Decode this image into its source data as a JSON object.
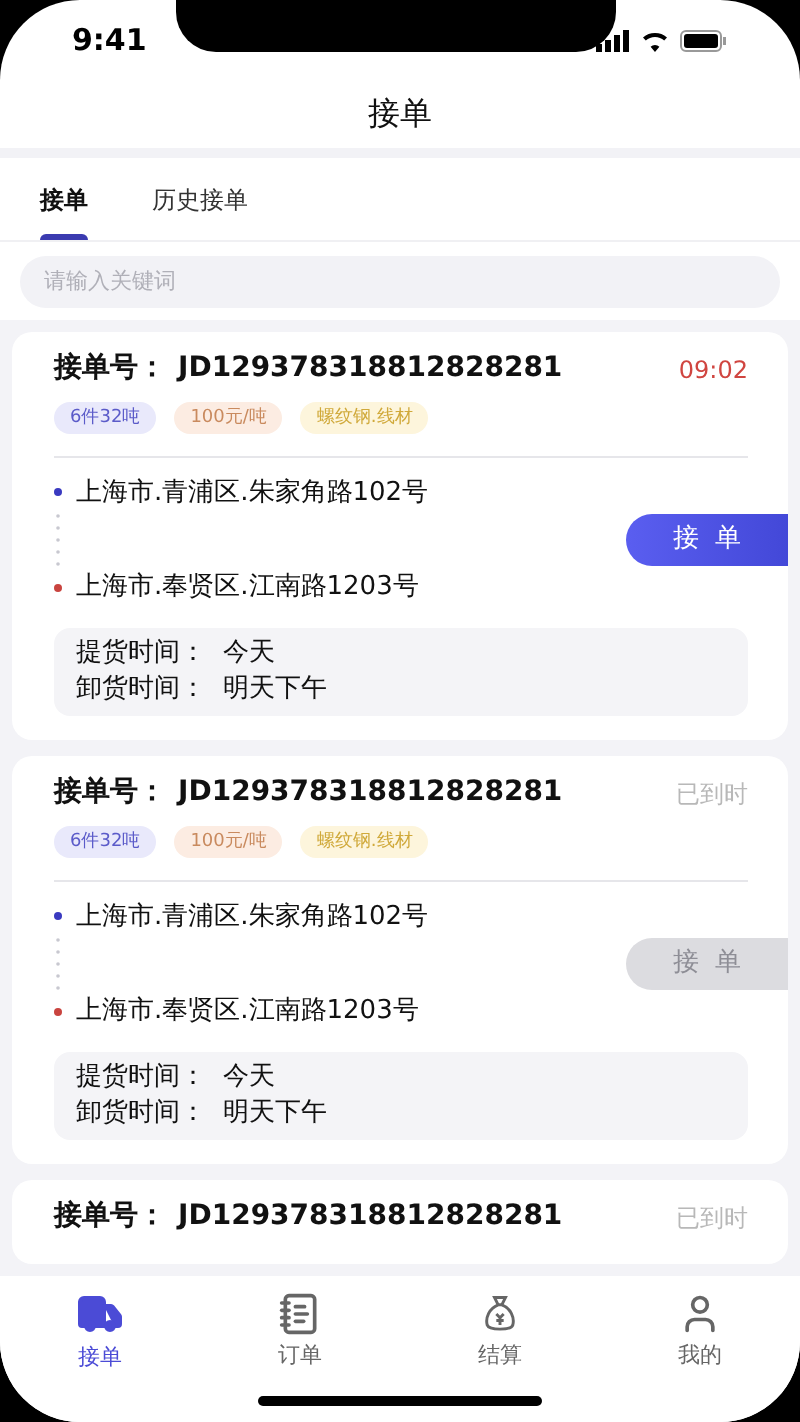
{
  "status_bar": {
    "time": "9:41"
  },
  "header": {
    "title": "接单"
  },
  "tabs": [
    {
      "label": "接单",
      "selected": true
    },
    {
      "label": "历史接单",
      "selected": false
    }
  ],
  "search": {
    "placeholder": "请输入关键词"
  },
  "orders": [
    {
      "number_label": "接单号：",
      "number": "JD129378318812828281",
      "status": "09:02",
      "overdue": false,
      "tags": [
        "6件32吨",
        "100元/吨",
        "螺纹钢.线材"
      ],
      "from": "上海市.青浦区.朱家角路102号",
      "to": "上海市.奉贤区.江南路1203号",
      "pickup": "提货时间：  今天",
      "unload": "卸货时间：  明天下午",
      "button": {
        "label": "接  单",
        "disabled": false
      }
    },
    {
      "number_label": "接单号：",
      "number": "JD129378318812828281",
      "status": "已到时",
      "overdue": true,
      "tags": [
        "6件32吨",
        "100元/吨",
        "螺纹钢.线材"
      ],
      "from": "上海市.青浦区.朱家角路102号",
      "to": "上海市.奉贤区.江南路1203号",
      "pickup": "提货时间：  今天",
      "unload": "卸货时间：  明天下午",
      "button": {
        "label": "接  单",
        "disabled": true
      }
    },
    {
      "number_label": "接单号：",
      "number": "JD129378318812828281",
      "status": "已到时",
      "overdue": true
    }
  ],
  "bottom_nav": [
    {
      "label": "接单",
      "kind": "truck",
      "selected": true
    },
    {
      "label": "订单",
      "kind": "order",
      "selected": false
    },
    {
      "label": "结算",
      "kind": "money",
      "selected": false
    },
    {
      "label": "我的",
      "kind": "user",
      "selected": false
    }
  ]
}
